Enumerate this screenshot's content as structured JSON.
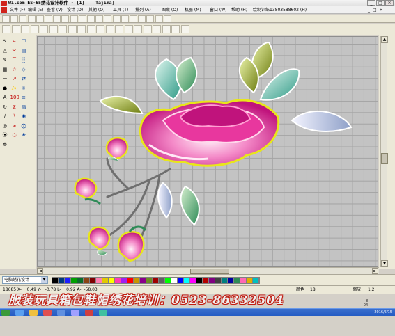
{
  "window": {
    "title": "Wilcom ES-65绣花设计软件 - [1]    Tajima]",
    "min": "_",
    "max": "□",
    "close": "×"
  },
  "menu": {
    "items": [
      "文件 (F)",
      "编辑 (E)",
      "查看 (V)",
      "设计 (D)",
      "其他 (O)",
      "工具 (T)",
      "排列 (A)",
      "图案 (O)",
      "机器 (M)",
      "窗口 (W)",
      "帮助 (H)",
      "绘制训练13803588602 (H)"
    ]
  },
  "toolbar1": {
    "buttons": [
      "new",
      "open",
      "save",
      "print",
      "cut",
      "copy",
      "paste",
      "undo",
      "redo",
      "zoom",
      "grid",
      "measure",
      "stitch",
      "view",
      "3d",
      "color",
      "hoop",
      "lock",
      "run",
      "info"
    ]
  },
  "toolbar2": {
    "buttons": [
      "select",
      "reshape",
      "node",
      "line",
      "curve",
      "fill",
      "satin",
      "tatami",
      "run",
      "outline",
      "lettering",
      "monogram",
      "appliqué",
      "border",
      "column",
      "hole",
      "3d-view",
      "auto",
      "trim",
      "jump"
    ],
    "labels": [
      "3D",
      "≣"
    ]
  },
  "leftbar": {
    "icons": [
      "↖",
      "⌗",
      "☐",
      "△",
      "✂",
      "▤",
      "✎",
      "⌒",
      "░",
      "▦",
      "☆",
      "◇",
      "→",
      "↗",
      "⇄",
      "●",
      "✨",
      "❈",
      "A",
      "1000",
      "≡",
      "↻",
      "⧖",
      "▧",
      "∕",
      "∖",
      "◉",
      "◎",
      "∞",
      "⨀",
      "⦿",
      "◌",
      "❀",
      "❁"
    ]
  },
  "bottom": {
    "combo_value": "电脑绣花设计",
    "palette": [
      "#000000",
      "#003a7c",
      "#1f1fff",
      "#00a000",
      "#0a6e28",
      "#8b4513",
      "#7f0000",
      "#ff7fb0",
      "#e1c800",
      "#ffff00",
      "#ff3cb4",
      "#a020f0",
      "#ff0000",
      "#c89600",
      "#8b008b",
      "#6b8e23",
      "#a00000",
      "#606060",
      "#00ff00",
      "#ffffff",
      "#0000ff",
      "#00ffff",
      "#ff00ff",
      "#000000",
      "#b40000",
      "#800080",
      "#404040",
      "#008080",
      "#0000a0",
      "#2e8b57",
      "#ff69b4",
      "#e0b000",
      "#00c0c0"
    ]
  },
  "status": {
    "left": "18685 X-    0.49 Y-   -0.78 L-    0.92 A-  -58.03",
    "color_label": "颜色",
    "color_value": "18",
    "zoom_label": "缩放",
    "zoom_value": "1.2"
  },
  "banner": {
    "text": "服装玩具箱包鞋帽绣花培训：0523-86332504"
  },
  "taskbar": {
    "clock": "2016/5/15"
  },
  "corner": {
    "text": "8\n-04"
  },
  "design": {
    "colors": {
      "leaf_green": "#2e8b57",
      "leaf_teal": "#3fa89a",
      "leaf_olive": "#8a9a1c",
      "petal_magenta": "#d41a8c",
      "petal_pink": "#f28ac7",
      "outline_yellow": "#e8e61a",
      "stem": "#6f6f6f",
      "leaf_lavender": "#8ea0c8"
    }
  }
}
